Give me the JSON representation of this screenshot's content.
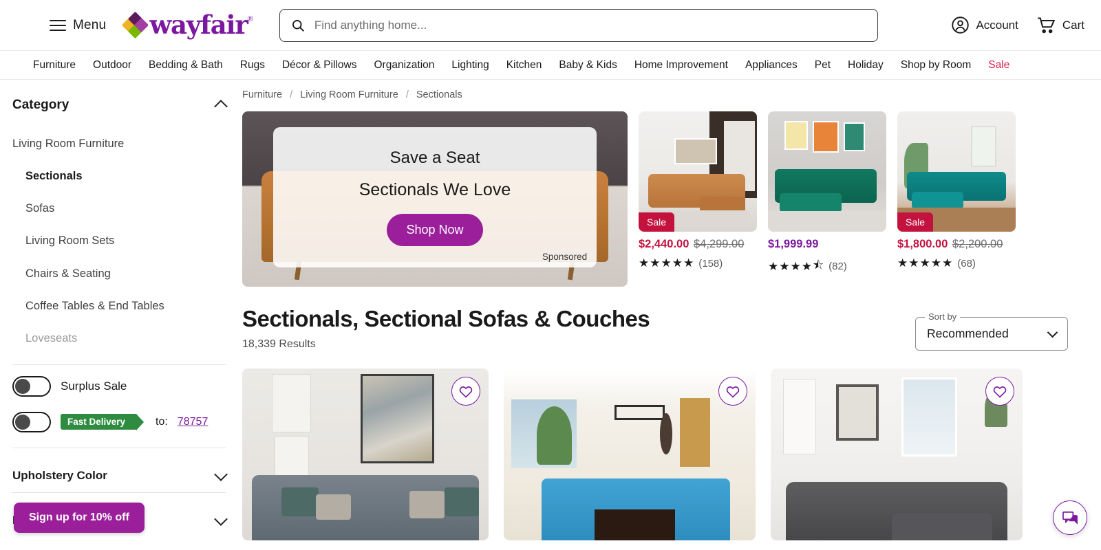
{
  "header": {
    "menu_label": "Menu",
    "logo_text": "wayfair",
    "search_placeholder": "Find anything home...",
    "search_value": "",
    "account_label": "Account",
    "cart_label": "Cart"
  },
  "nav": {
    "items": [
      {
        "label": "Furniture",
        "sale": false
      },
      {
        "label": "Outdoor",
        "sale": false
      },
      {
        "label": "Bedding & Bath",
        "sale": false
      },
      {
        "label": "Rugs",
        "sale": false
      },
      {
        "label": "Décor & Pillows",
        "sale": false
      },
      {
        "label": "Organization",
        "sale": false
      },
      {
        "label": "Lighting",
        "sale": false
      },
      {
        "label": "Kitchen",
        "sale": false
      },
      {
        "label": "Baby & Kids",
        "sale": false
      },
      {
        "label": "Home Improvement",
        "sale": false
      },
      {
        "label": "Appliances",
        "sale": false
      },
      {
        "label": "Pet",
        "sale": false
      },
      {
        "label": "Holiday",
        "sale": false
      },
      {
        "label": "Shop by Room",
        "sale": false
      },
      {
        "label": "Sale",
        "sale": true
      }
    ]
  },
  "sidebar": {
    "category_header": "Category",
    "items": [
      {
        "label": "Living Room Furniture",
        "level": 0,
        "active": false,
        "faded": false
      },
      {
        "label": "Sectionals",
        "level": 1,
        "active": true,
        "faded": false
      },
      {
        "label": "Sofas",
        "level": 1,
        "active": false,
        "faded": false
      },
      {
        "label": "Living Room Sets",
        "level": 1,
        "active": false,
        "faded": false
      },
      {
        "label": "Chairs & Seating",
        "level": 1,
        "active": false,
        "faded": false
      },
      {
        "label": "Coffee Tables & End Tables",
        "level": 1,
        "active": false,
        "faded": false
      },
      {
        "label": "Loveseats",
        "level": 1,
        "active": false,
        "faded": true
      }
    ],
    "surplus_toggle_label": "Surplus Sale",
    "fast_delivery_badge": "Fast Delivery",
    "fast_delivery_to": "to:",
    "zip_code": "78757",
    "filters": [
      {
        "label": "Upholstery Color"
      },
      {
        "label": "Price Per Item"
      }
    ],
    "signup_banner": "Sign up for 10% off"
  },
  "main": {
    "breadcrumb": [
      "Furniture",
      "Living Room Furniture",
      "Sectionals"
    ],
    "hero": {
      "line1": "Save a Seat",
      "line2": "Sectionals We Love",
      "cta": "Shop Now",
      "sponsored_label": "Sponsored"
    },
    "featured_products": [
      {
        "price_now": "$2,440.00",
        "price_was": "$4,299.00",
        "on_sale": true,
        "sale_tag": "Sale",
        "rating": 5,
        "reviews": "(158)"
      },
      {
        "price_now": "$1,999.99",
        "price_was": "",
        "on_sale": false,
        "sale_tag": "",
        "rating": 4.5,
        "reviews": "(82)"
      },
      {
        "price_now": "$1,800.00",
        "price_was": "$2,200.00",
        "on_sale": true,
        "sale_tag": "Sale",
        "rating": 5,
        "reviews": "(68)"
      }
    ],
    "page_title": "Sectionals, Sectional Sofas & Couches",
    "results_count": "18,339 Results",
    "sort": {
      "label": "Sort by",
      "value": "Recommended"
    },
    "grid_products": [
      {
        "alt": "gray-sectional-with-pillows"
      },
      {
        "alt": "blue-u-shaped-sectional"
      },
      {
        "alt": "dark-gray-modular-sectional"
      }
    ]
  },
  "colors": {
    "brand_purple": "#7b189f",
    "sale_red": "#c4123f",
    "nav_sale_red": "#d7224c",
    "delivery_green": "#2e8b40",
    "banner_purple": "#9b1f9b"
  },
  "icons": {
    "search": "search-icon",
    "account": "account-icon",
    "cart": "cart-icon",
    "heart": "heart-icon",
    "chat": "chat-icon"
  }
}
